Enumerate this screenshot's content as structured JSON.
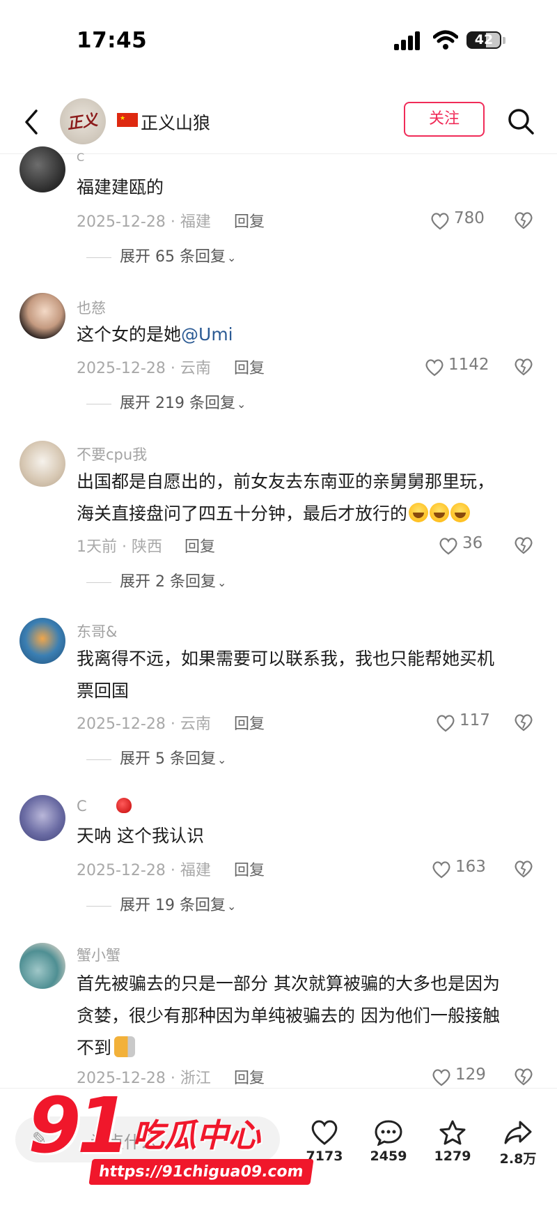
{
  "status": {
    "time": "17:45",
    "battery": "42"
  },
  "header": {
    "author_name": "正义山狼",
    "follow_label": "关注"
  },
  "comments": [
    {
      "user": "C",
      "text": "福建建瓯的",
      "date_loc": "2025-12-28 · 福建",
      "reply": "回复",
      "likes": "780",
      "expand": "展开 65 条回复"
    },
    {
      "user": "也慈",
      "text": "这个女的是她",
      "mention": "@Umi",
      "date_loc": "2025-12-28 · 云南",
      "reply": "回复",
      "likes": "1142",
      "expand": "展开 219 条回复"
    },
    {
      "user": "不要cpu我",
      "text_line1": "出国都是自愿出的，前女友去东南亚的亲舅舅那里玩，",
      "text_line2": "海关直接盘问了四五十分钟，最后才放行的",
      "date_loc": "1天前 · 陕西",
      "reply": "回复",
      "likes": "36",
      "expand": "展开 2 条回复"
    },
    {
      "user": "东哥&",
      "text_line1": "我离得不远，如果需要可以联系我，我也只能帮她买机",
      "text_line2": "票回国",
      "date_loc": "2025-12-28 · 云南",
      "reply": "回复",
      "likes": "117",
      "expand": "展开 5 条回复"
    },
    {
      "user": "C",
      "text": "天呐  这个我认识",
      "date_loc": "2025-12-28 · 福建",
      "reply": "回复",
      "likes": "163",
      "expand": "展开 19 条回复"
    },
    {
      "user": "蟹小蟹",
      "text_line1": "首先被骗去的只是一部分  其次就算被骗的大多也是因为",
      "text_line2": "贪婪，很少有那种因为单纯被骗去的 因为他们一般接触",
      "text_line3": "不到",
      "date_loc": "2025-12-28 · 浙江",
      "reply": "回复",
      "likes": "129"
    }
  ],
  "bottom_bar": {
    "input_placeholder": "说点什么...",
    "likes": "7173",
    "comments": "2459",
    "favorites": "1279",
    "shares": "2.8万"
  },
  "watermark": {
    "number": "91",
    "brand": "吃瓜中心",
    "url": "https://91chigua09.com"
  },
  "colors": {
    "accent": "#f02b58",
    "mention": "#2c5b94",
    "watermark": "#f0172b"
  }
}
